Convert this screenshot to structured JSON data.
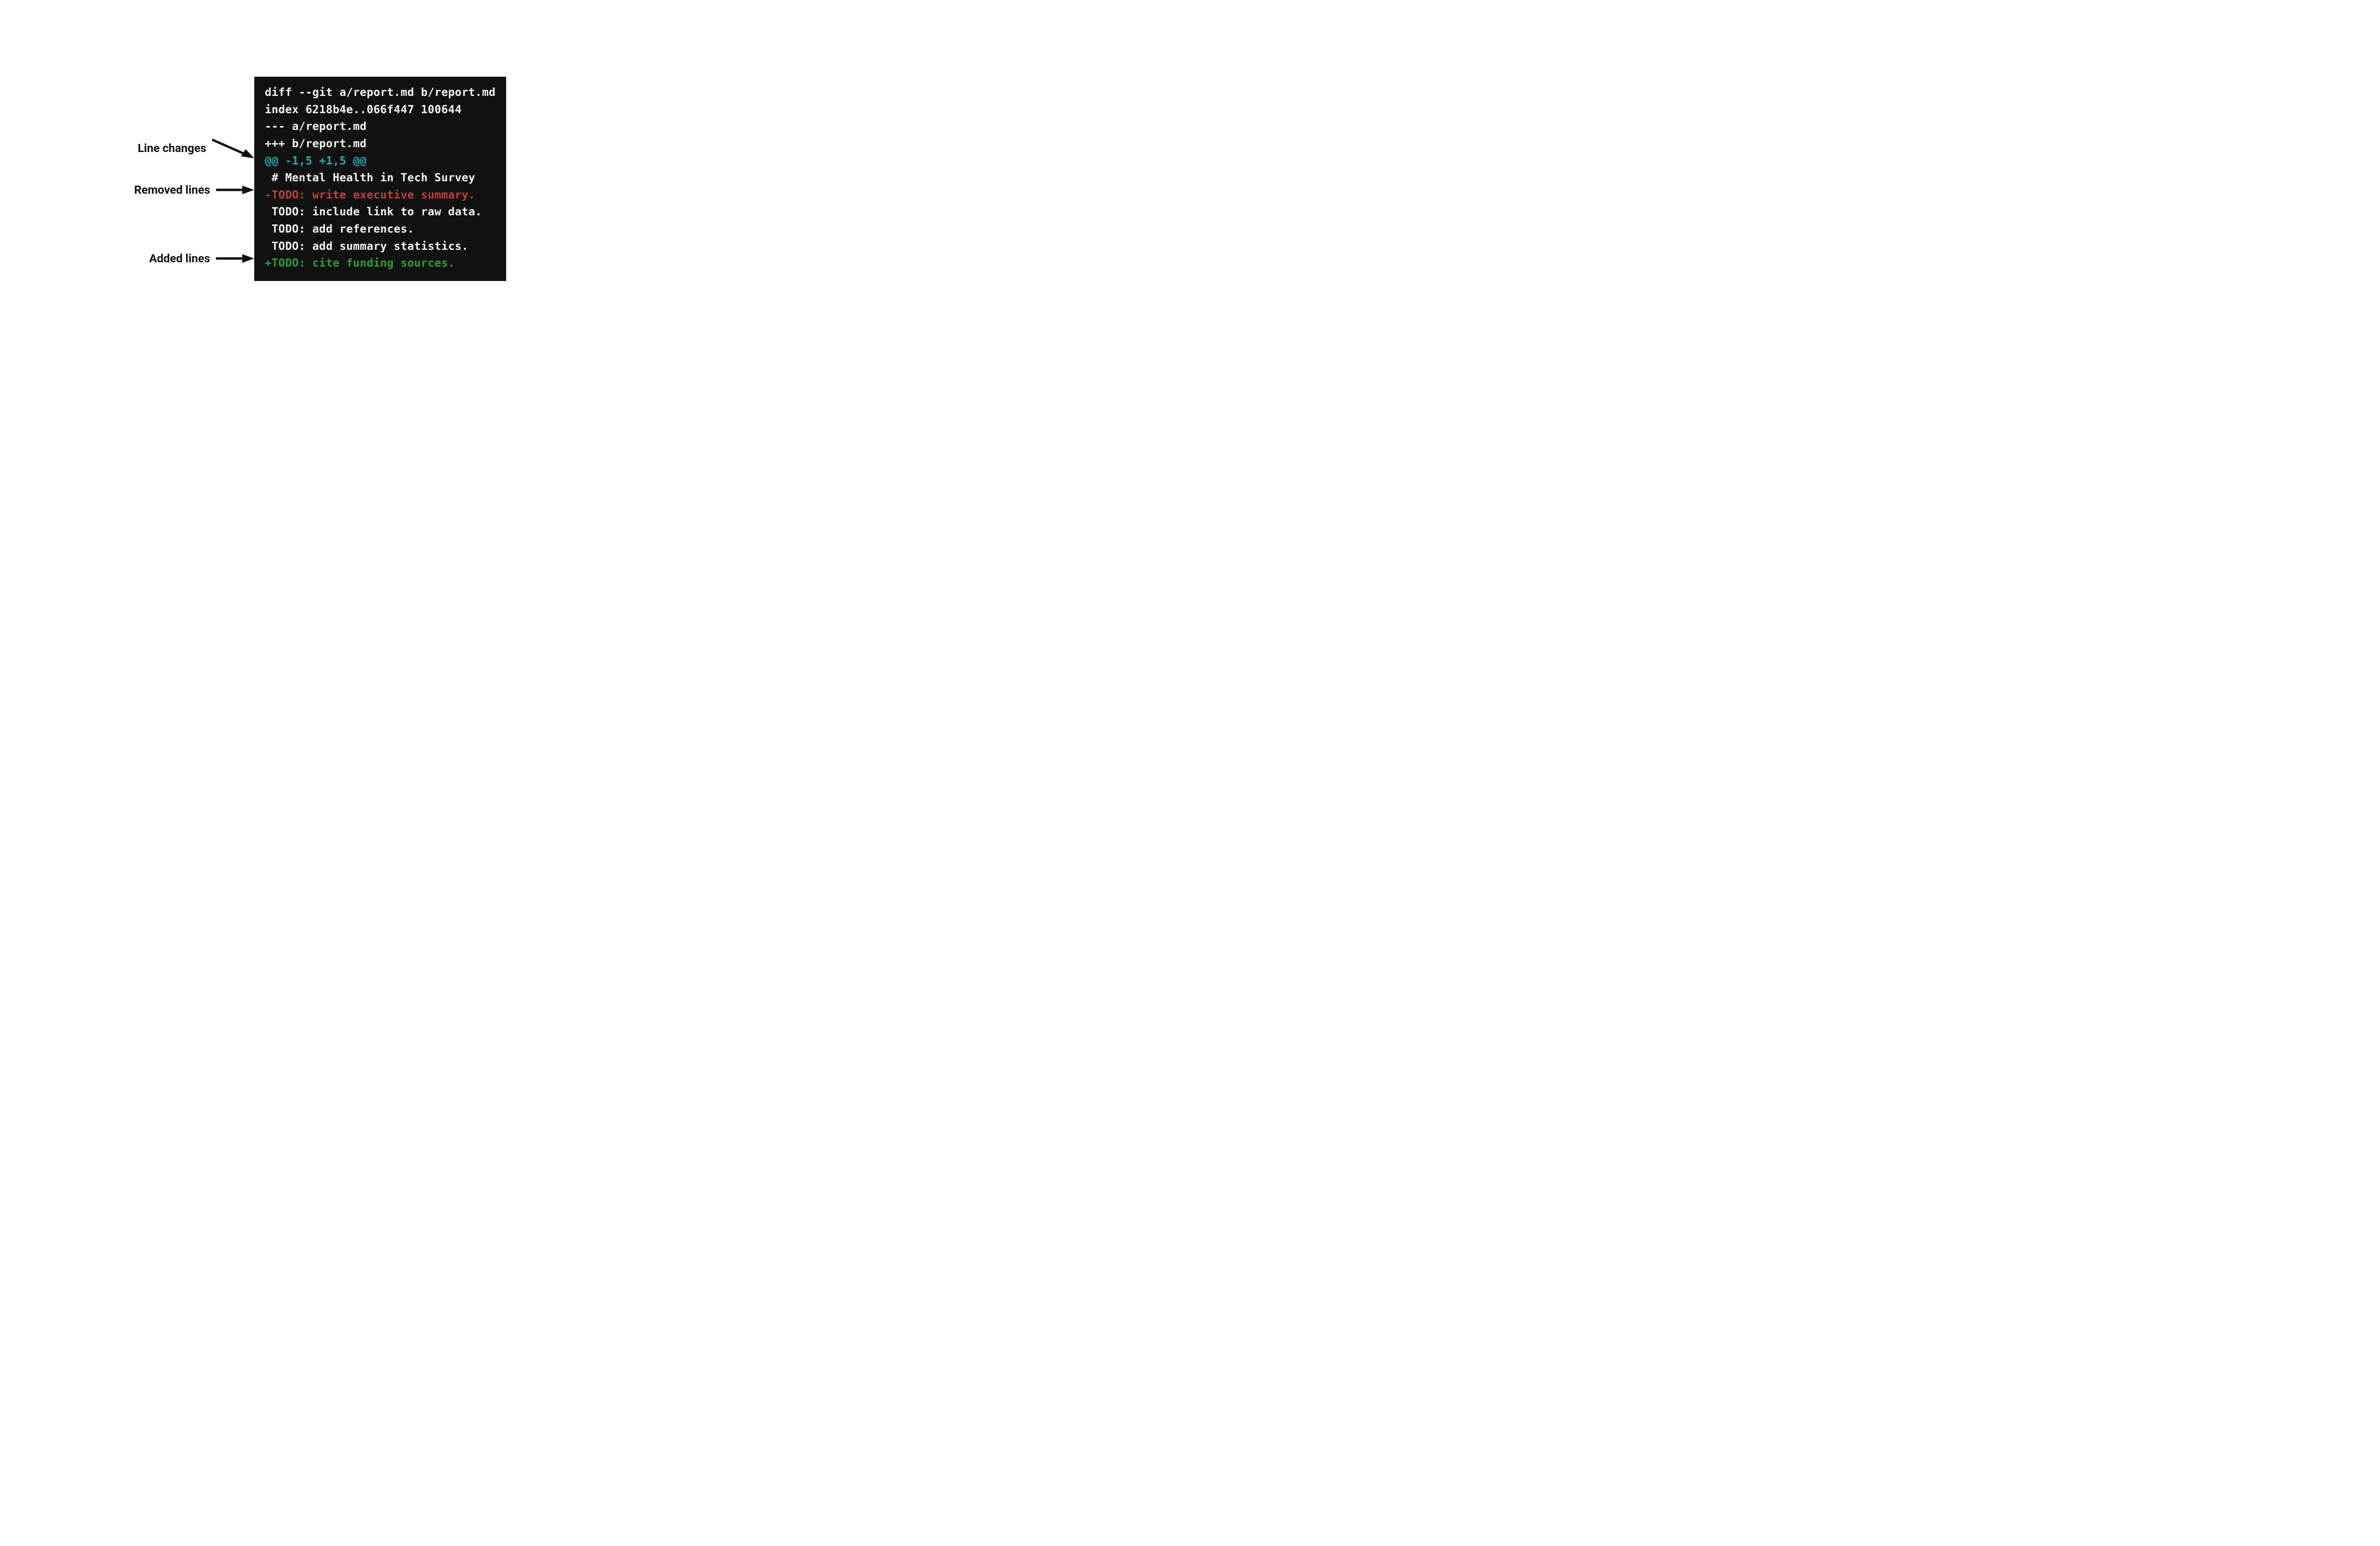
{
  "labels": {
    "line_changes": "Line changes",
    "removed_lines": "Removed lines",
    "added_lines": "Added lines"
  },
  "diff": {
    "header1": "diff --git a/report.md b/report.md",
    "header2": "index 6218b4e..066f447 100644",
    "header3": "--- a/report.md",
    "header4": "+++ b/report.md",
    "hunk": "@@ -1,5 +1,5 @@",
    "context1": " # Mental Health in Tech Survey",
    "removed1": "-TODO: write executive summary.",
    "context2": " TODO: include link to raw data.",
    "context3": " TODO: add references.",
    "context4": " TODO: add summary statistics.",
    "added1": "+TODO: cite funding sources."
  },
  "colors": {
    "terminal_bg": "#111111",
    "white": "#f2f2f2",
    "cyan": "#2aa8b8",
    "red": "#c23f3a",
    "green": "#2e9d3a",
    "label": "#111111"
  }
}
